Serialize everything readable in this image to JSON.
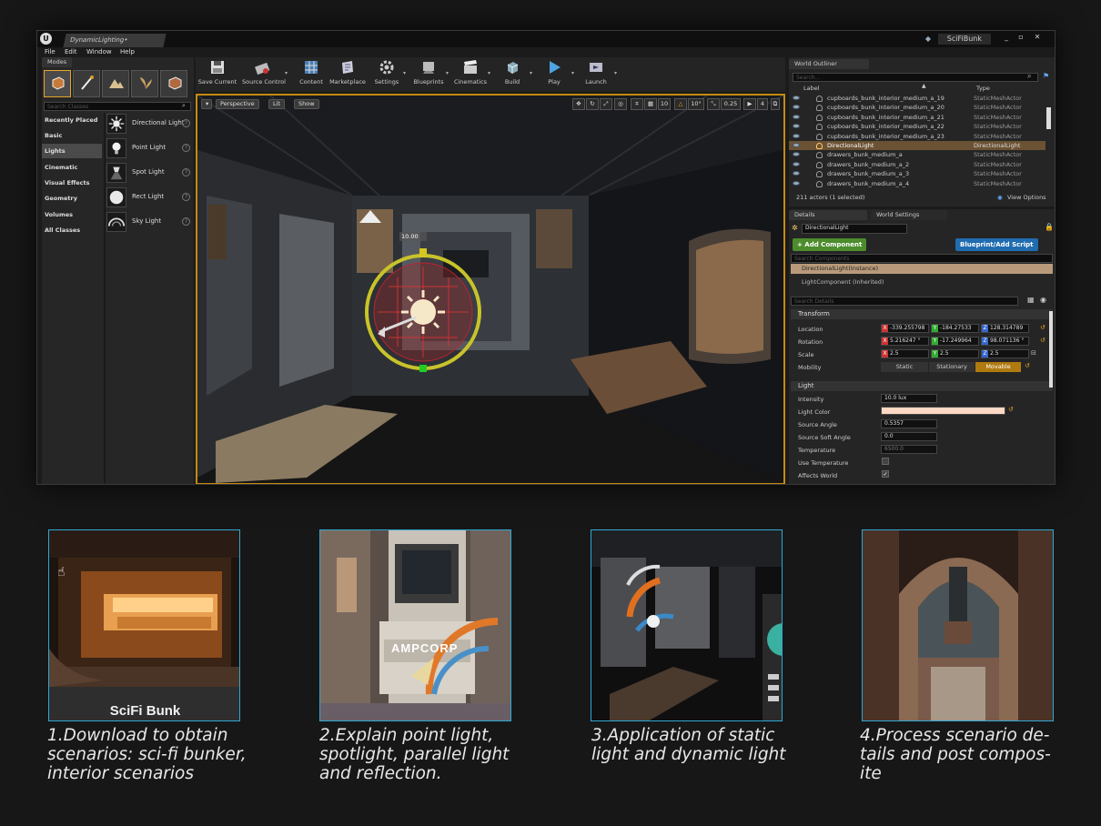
{
  "editor": {
    "doc_tab": "DynamicLighting•",
    "project": "SciFiBunk",
    "window_buttons": [
      "_",
      "▫",
      "✕"
    ],
    "menu": [
      "File",
      "Edit",
      "Window",
      "Help"
    ]
  },
  "modes": {
    "tab": "Modes",
    "search_placeholder": "Search Classes",
    "categories": [
      "Recently Placed",
      "Basic",
      "Lights",
      "Cinematic",
      "Visual Effects",
      "Geometry",
      "Volumes",
      "All Classes"
    ],
    "selected_category": "Lights",
    "items": [
      "Directional Light",
      "Point Light",
      "Spot Light",
      "Rect Light",
      "Sky Light"
    ]
  },
  "toolbar": [
    "Save Current",
    "Source Control",
    "Content",
    "Marketplace",
    "Settings",
    "Blueprints",
    "Cinematics",
    "Build",
    "Play",
    "Launch"
  ],
  "viewport": {
    "view_mode": "Perspective",
    "lit_mode": "Lit",
    "show_label": "Show",
    "grid_snap": "10",
    "rot_snap": "10°",
    "scale_snap": "0.25",
    "camera_speed": "4",
    "gizmo_label": "10.00"
  },
  "outliner": {
    "tab": "World Outliner",
    "search_placeholder": "Search...",
    "col_label": "Label",
    "col_type": "Type",
    "rows": [
      {
        "name": "cupboards_bunk_interior_medium_a_19",
        "type": "StaticMeshActor",
        "selected": false
      },
      {
        "name": "cupboards_bunk_interior_medium_a_20",
        "type": "StaticMeshActor",
        "selected": false
      },
      {
        "name": "cupboards_bunk_interior_medium_a_21",
        "type": "StaticMeshActor",
        "selected": false
      },
      {
        "name": "cupboards_bunk_interior_medium_a_22",
        "type": "StaticMeshActor",
        "selected": false
      },
      {
        "name": "cupboards_bunk_interior_medium_a_23",
        "type": "StaticMeshActor",
        "selected": false
      },
      {
        "name": "DirectionalLight",
        "type": "DirectionalLight",
        "selected": true
      },
      {
        "name": "drawers_bunk_medium_a",
        "type": "StaticMeshActor",
        "selected": false
      },
      {
        "name": "drawers_bunk_medium_a_2",
        "type": "StaticMeshActor",
        "selected": false
      },
      {
        "name": "drawers_bunk_medium_a_3",
        "type": "StaticMeshActor",
        "selected": false
      },
      {
        "name": "drawers_bunk_medium_a_4",
        "type": "StaticMeshActor",
        "selected": false
      }
    ],
    "status": "211 actors (1 selected)",
    "view_options": "View Options"
  },
  "details": {
    "tab_details": "Details",
    "tab_world": "World Settings",
    "actor_name": "DirectionalLight",
    "add_component": "+ Add Component",
    "blueprint": "Blueprint/Add Script",
    "search_components": "Search Components",
    "instance_row": "DirectionalLight(Instance)",
    "component_row": "LightComponent (Inherited)",
    "search_details": "Search Details",
    "transform_section": "Transform",
    "location_label": "Location",
    "location": [
      "-339.255798",
      "-184.27533",
      "128.314789"
    ],
    "rotation_label": "Rotation",
    "rotation": [
      "5.216247 °",
      "-17.249964",
      "98.071136 °"
    ],
    "scale_label": "Scale",
    "scale": [
      "2.5",
      "2.5",
      "2.5"
    ],
    "mobility_label": "Mobility",
    "mobility_options": [
      "Static",
      "Stationary",
      "Movable"
    ],
    "mobility_selected": "Movable",
    "light_section": "Light",
    "props": [
      {
        "label": "Intensity",
        "value": "10.0 lux"
      },
      {
        "label": "Light Color",
        "value": ""
      },
      {
        "label": "Source Angle",
        "value": "0.5357"
      },
      {
        "label": "Source Soft Angle",
        "value": "0.0"
      },
      {
        "label": "Temperature",
        "value": "6500.0"
      },
      {
        "label": "Use Temperature",
        "value": ""
      },
      {
        "label": "Affects World",
        "value": ""
      }
    ]
  },
  "cards": [
    {
      "caption": "1.Download to obtain scenarios: sci-fi bunker, interior scenarios",
      "overlay": "SciFi Bunk"
    },
    {
      "caption": "2.Explain point light, spotlight, parallel light and reflection.",
      "overlay": ""
    },
    {
      "caption": "3.Application of static light and dynamic light",
      "overlay": ""
    },
    {
      "caption": "4.Process scenario de-tails and post compos-ite",
      "overlay": ""
    }
  ],
  "colors": {
    "accent": "#c58a12",
    "selection": "#6b5234",
    "card_border": "#2fa7d6",
    "green_button": "#4c8c2c",
    "blue_button": "#1f6cb0"
  }
}
